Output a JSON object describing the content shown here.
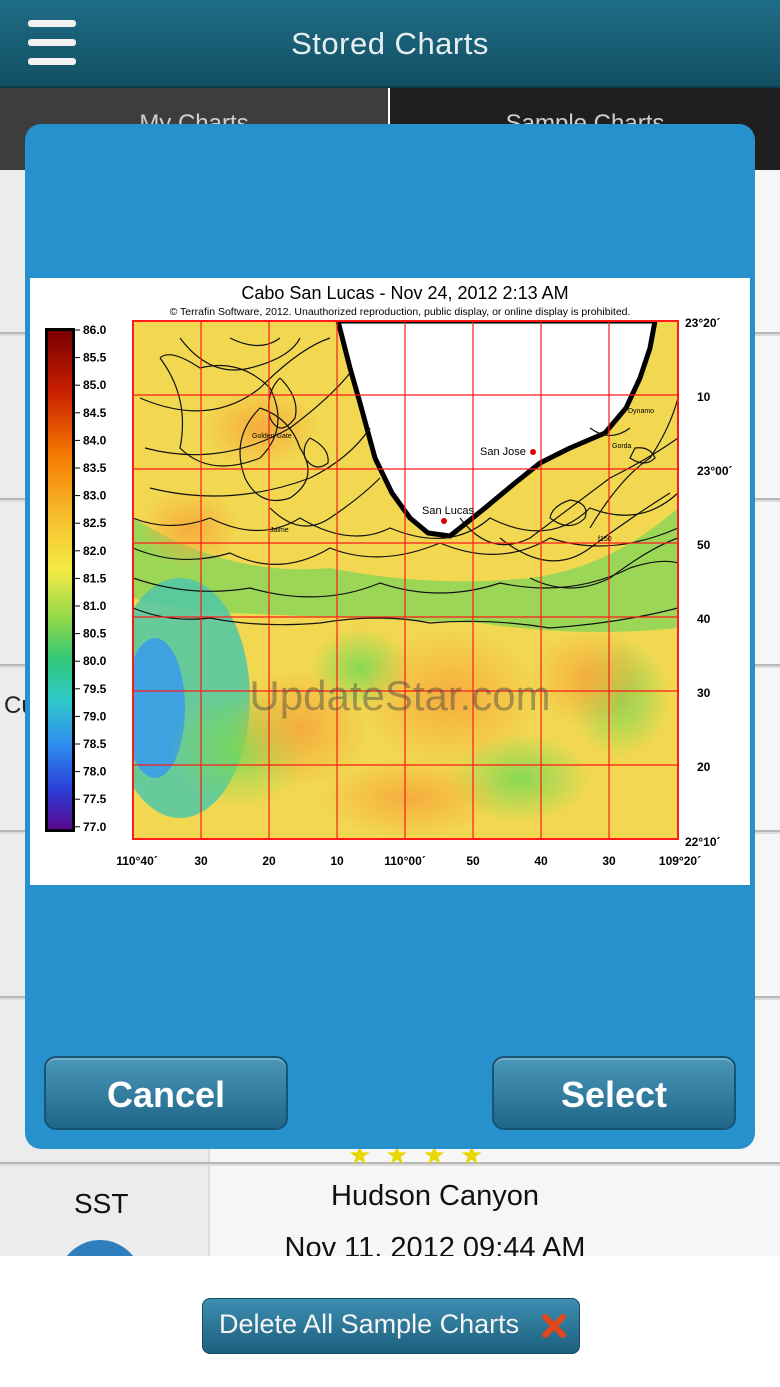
{
  "header": {
    "title": "Stored Charts",
    "menu_icon": "hamburger-menu-icon"
  },
  "tabs": [
    {
      "label": "My Charts"
    },
    {
      "label": "Sample Charts"
    }
  ],
  "list": {
    "partial_left_text": "Cu",
    "visible_row": {
      "type_label": "SST",
      "title": "Hudson Canyon",
      "date": "Nov 11, 2012  09:44 AM"
    }
  },
  "bottom_bar": {
    "delete_label": "Delete All Sample Charts",
    "delete_icon": "red-x-icon"
  },
  "dialog": {
    "cancel_label": "Cancel",
    "select_label": "Select",
    "chart": {
      "title": "Cabo San Lucas - Nov 24, 2012 2:13 AM",
      "copyright": "© Terrafin Software,  2012.  Unauthorized reproduction, public display, or online display is prohibited.",
      "watermark": "UpdateStar.com",
      "place_labels": {
        "san_jose": "San Jose",
        "san_lucas": "San Lucas",
        "golden_gate": "Golden Gate",
        "jaime": "Jaime",
        "dynamo": "Dynamo",
        "gorda": "Gorda",
        "f150": "f150"
      },
      "colorbar_ticks": [
        "86.0",
        "85.5",
        "85.0",
        "84.5",
        "84.0",
        "83.5",
        "83.0",
        "82.5",
        "82.0",
        "81.5",
        "81.0",
        "80.5",
        "80.0",
        "79.5",
        "79.0",
        "78.5",
        "78.0",
        "77.5",
        "77.0"
      ],
      "x_ticks": [
        "110°40´",
        "30",
        "20",
        "10",
        "110°00´",
        "50",
        "40",
        "30",
        "109°20´"
      ],
      "y_ticks": [
        "23°20´",
        "10",
        "23°00´",
        "50",
        "40",
        "30",
        "20",
        "22°10´"
      ]
    }
  }
}
